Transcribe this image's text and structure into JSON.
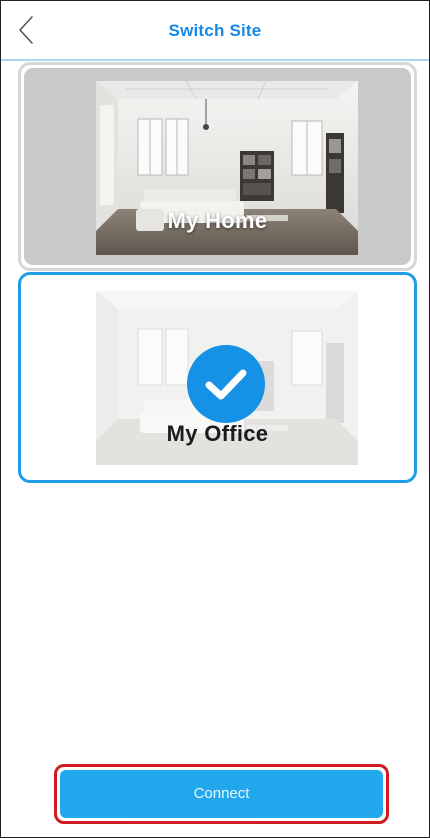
{
  "header": {
    "title": "Switch Site",
    "back_icon": "chevron-left-icon"
  },
  "sites": [
    {
      "label": "My Home",
      "selected": false
    },
    {
      "label": "My Office",
      "selected": true
    }
  ],
  "check_icon": "checkmark-icon",
  "connect_button": {
    "label": "Connect"
  },
  "colors": {
    "accent": "#1688e6",
    "selected_border": "#1f9ee7",
    "button_bg": "#1ea6ec",
    "highlight_border": "#d11a22"
  }
}
